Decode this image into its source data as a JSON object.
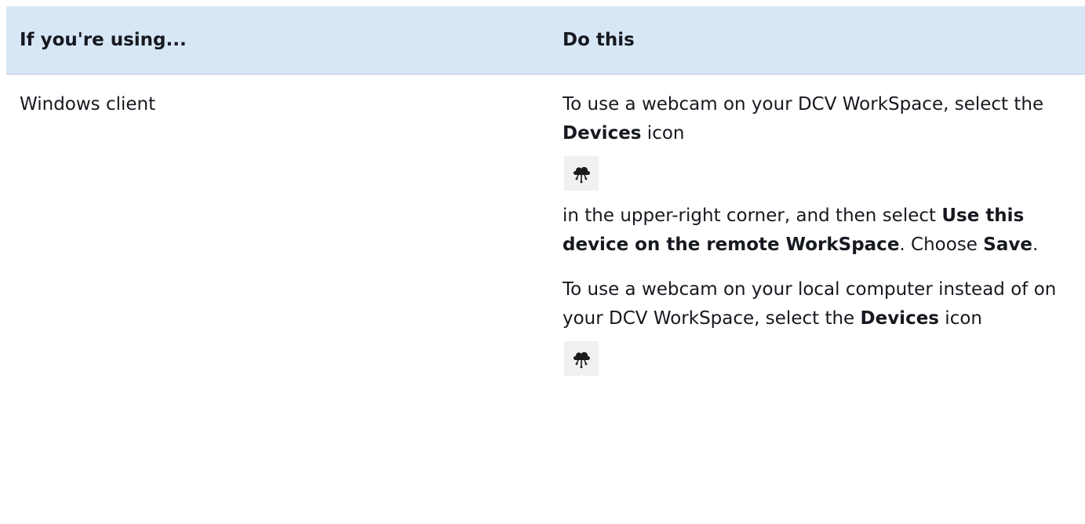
{
  "table": {
    "headers": {
      "col1": "If you're using...",
      "col2": "Do this"
    },
    "row": {
      "client": "Windows client",
      "p1": {
        "t1": "To use a webcam on your DCV WorkSpace, select the ",
        "b1": "Devices",
        "t2": " icon"
      },
      "p2": {
        "t1": "in the upper-right corner, and then select ",
        "b1": "Use this device on the remote WorkSpace",
        "t2": ". Choose ",
        "b2": "Save",
        "t3": "."
      },
      "p3": {
        "t1": "To use a webcam on your local computer instead of on your DCV WorkSpace, select the ",
        "b1": "Devices",
        "t2": " icon"
      }
    },
    "icons": {
      "devices_icon_1": "devices-icon",
      "devices_icon_2": "devices-icon"
    }
  }
}
